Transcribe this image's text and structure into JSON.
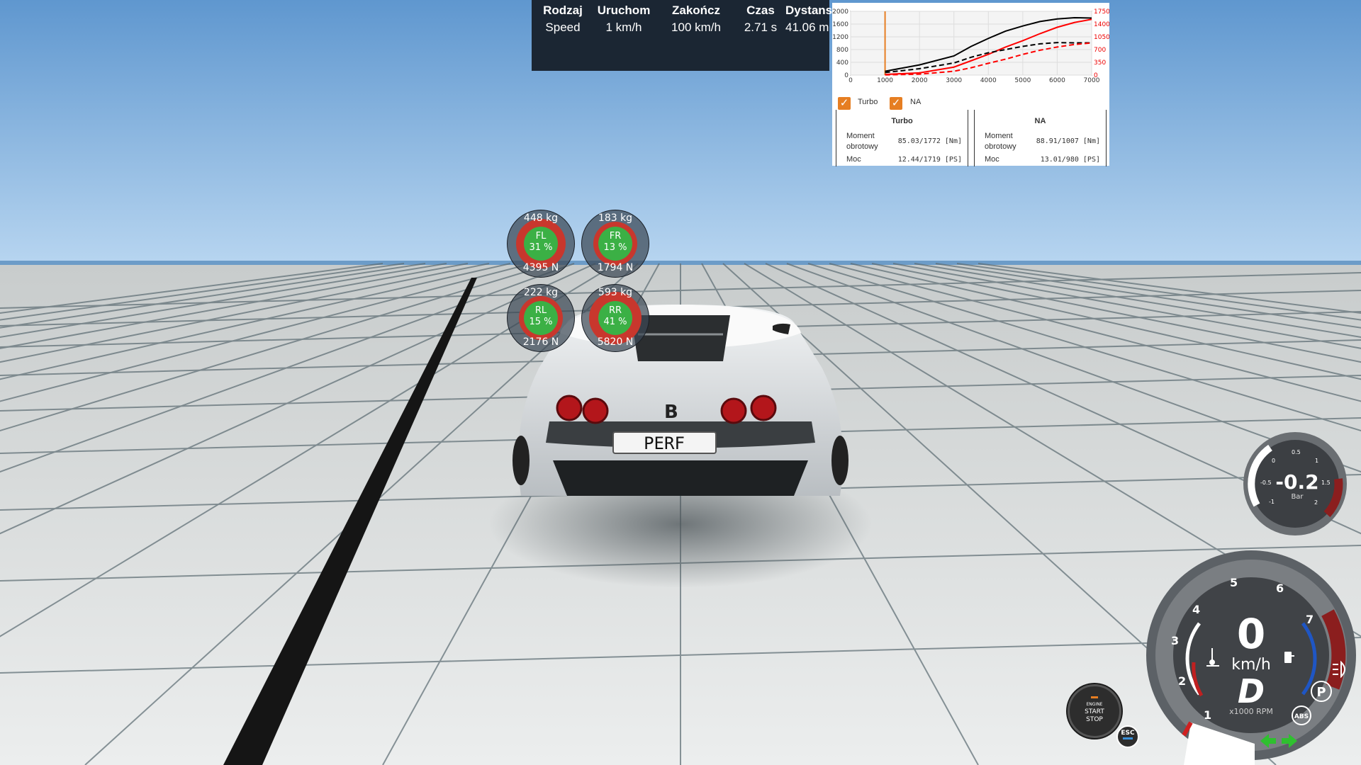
{
  "timing": {
    "headers": [
      "Rodzaj",
      "Uruchom",
      "Zakończ",
      "Czas",
      "Dystans"
    ],
    "values": [
      "Speed",
      "1 km/h",
      "100 km/h",
      "2.71 s",
      "41.06 m"
    ]
  },
  "dyno": {
    "chart_data": {
      "type": "line",
      "x_ticks": [
        "0",
        "1000",
        "2000",
        "3000",
        "4000",
        "5000",
        "6000",
        "7000"
      ],
      "y_left_ticks": [
        "0",
        "400",
        "800",
        "1200",
        "1600",
        "2000"
      ],
      "y_right_ticks": [
        "0",
        "350",
        "700",
        "1050",
        "1400",
        "1750"
      ],
      "xlim": [
        0,
        7000
      ],
      "ylim_left": [
        0,
        2000
      ],
      "ylim_right": [
        0,
        1750
      ],
      "marker_rpm": 1000,
      "series": [
        {
          "key": "turbo_torque",
          "color": "#000000",
          "dash": false,
          "x": [
            1000,
            2000,
            3000,
            3500,
            4000,
            4500,
            5000,
            5500,
            6000,
            6500,
            7000
          ],
          "y": [
            120,
            320,
            600,
            900,
            1150,
            1380,
            1540,
            1680,
            1760,
            1800,
            1790
          ]
        },
        {
          "key": "turbo_power",
          "color": "#ff0000",
          "dash": false,
          "x": [
            1000,
            2000,
            3000,
            3500,
            4000,
            4500,
            5000,
            5500,
            6000,
            6500,
            7000
          ],
          "y": [
            20,
            70,
            250,
            450,
            650,
            880,
            1080,
            1300,
            1500,
            1650,
            1750
          ]
        },
        {
          "key": "na_torque",
          "color": "#000000",
          "dash": true,
          "x": [
            1000,
            2000,
            3000,
            3500,
            4000,
            4500,
            5000,
            5500,
            6000,
            6500,
            7000
          ],
          "y": [
            80,
            200,
            380,
            560,
            700,
            800,
            900,
            980,
            1020,
            1010,
            1010
          ]
        },
        {
          "key": "na_power",
          "color": "#ff0000",
          "dash": true,
          "x": [
            1000,
            2000,
            3000,
            3500,
            4000,
            4500,
            5000,
            5500,
            6000,
            6500,
            7000
          ],
          "y": [
            5,
            30,
            120,
            230,
            370,
            500,
            650,
            780,
            880,
            960,
            1010
          ]
        }
      ]
    },
    "turbo": {
      "label": "Turbo",
      "title": "Turbo",
      "torque_label": "Moment obrotowy",
      "torque_value": "85.03/1772 [Nm]",
      "power_label": "Moc",
      "power_value": "12.44/1719 [PS]"
    },
    "na": {
      "label": "NA",
      "title": "NA",
      "torque_label": "Moment obrotowy",
      "torque_value": "88.91/1007 [Nm]",
      "power_label": "Moc",
      "power_value": "13.01/980 [PS]"
    },
    "check_glyph": "✓"
  },
  "tires": {
    "fl": {
      "kg": "448 kg",
      "pos": "FL",
      "pct": "31 %",
      "n": "4395 N",
      "load": 0.31
    },
    "fr": {
      "kg": "183 kg",
      "pos": "FR",
      "pct": "13 %",
      "n": "1794 N",
      "load": 0.13
    },
    "rl": {
      "kg": "222 kg",
      "pos": "RL",
      "pct": "15 %",
      "n": "2176 N",
      "load": 0.15
    },
    "rr": {
      "kg": "593 kg",
      "pos": "RR",
      "pct": "41 %",
      "n": "5820 N",
      "load": 0.41
    }
  },
  "plate": "PERF",
  "engine_button": {
    "line1": "ENGINE",
    "line2": "START",
    "line3": "STOP"
  },
  "esc": {
    "label": "ESC"
  },
  "boost": {
    "value": "-0.2",
    "unit": "Bar",
    "ticks": [
      "-1",
      "-0.5",
      "0",
      "0.5",
      "1",
      "1.5",
      "2"
    ]
  },
  "gauge": {
    "speed": "0",
    "unit": "km/h",
    "gear": "D",
    "rpm_label": "x1000 RPM",
    "rpm_ticks": [
      "1",
      "2",
      "3",
      "4",
      "5",
      "6",
      "7"
    ],
    "parking": "P",
    "abs": "ABS"
  },
  "colors": {
    "sky_top": "#6fa4d6",
    "sky_bottom": "#b4d3ef",
    "floor": "#d9dcdc",
    "tire_green": "#3bb045",
    "tire_red": "#c8372d",
    "accent": "#e67e22"
  },
  "icons": {
    "engine_temp": "thermometer-icon",
    "fuel": "fuel-pump-icon",
    "lights": "headlight-icon",
    "indicator_left": "arrow-left-icon",
    "indicator_right": "arrow-right-icon"
  }
}
